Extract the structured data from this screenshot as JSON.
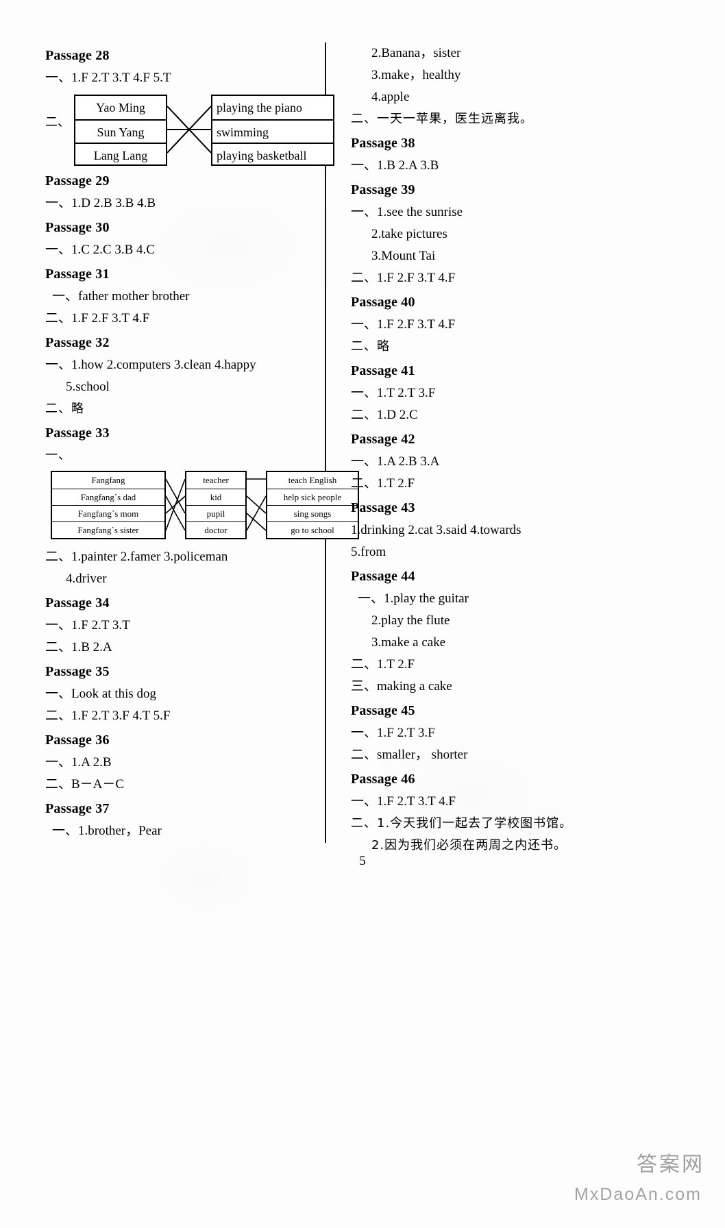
{
  "page": {
    "number": "5",
    "watermark_cjk": "答案网",
    "watermark_latin": "MxDaoAn.com"
  },
  "left_column": {
    "passages": [
      {
        "title": "Passage 28",
        "lines": [
          {
            "text": "一、1.F   2.T   3.T   4.F   5.T"
          }
        ],
        "diagram": {
          "type": "match-2col",
          "label": "二、",
          "left_items": [
            "Yao Ming",
            "Sun Yang",
            "Lang Lang"
          ],
          "right_items": [
            "playing the piano",
            "swimming",
            "playing basketball"
          ],
          "connections": [
            [
              0,
              2
            ],
            [
              1,
              1
            ],
            [
              2,
              0
            ]
          ]
        }
      },
      {
        "title": "Passage 29",
        "lines": [
          {
            "text": "一、1.D   2.B   3.B   4.B"
          }
        ]
      },
      {
        "title": "Passage 30",
        "lines": [
          {
            "text": "一、1.C   2.C   3.B   4.C"
          }
        ]
      },
      {
        "title": "Passage 31",
        "lines": [
          {
            "text": "一、father   mother   brother"
          },
          {
            "text": "二、1.F   2.F   3.T   4.F"
          }
        ]
      },
      {
        "title": "Passage 32",
        "lines": [
          {
            "text": "一、1.how   2.computers  3.clean   4.happy"
          },
          {
            "text": "5.school",
            "indent": true
          },
          {
            "text": "二、略"
          }
        ]
      },
      {
        "title": "Passage 33",
        "lines": [
          {
            "text": "一、"
          }
        ],
        "diagram": {
          "type": "match-3col",
          "col1": [
            "Fangfang",
            "Fangfang`s dad",
            "Fangfang`s mom",
            "Fangfang`s sister"
          ],
          "col2": [
            "teacher",
            "kid",
            "pupil",
            "doctor"
          ],
          "col3": [
            "teach English",
            "help sick people",
            "sing songs",
            "go to school"
          ],
          "links_a": [
            [
              0,
              2
            ],
            [
              1,
              3
            ],
            [
              2,
              1
            ],
            [
              3,
              0
            ]
          ],
          "links_b": [
            [
              0,
              0
            ],
            [
              1,
              2
            ],
            [
              2,
              3
            ],
            [
              3,
              1
            ]
          ]
        },
        "lines_after": [
          {
            "text": "二、1.painter   2.famer   3.policeman"
          },
          {
            "text": "4.driver",
            "indent": true
          }
        ]
      },
      {
        "title": "Passage 34",
        "lines": [
          {
            "text": "一、1.F   2.T   3.T"
          },
          {
            "text": "二、1.B   2.A"
          }
        ]
      },
      {
        "title": "Passage 35",
        "lines": [
          {
            "text": "一、Look at this dog"
          },
          {
            "text": "二、1.F   2.T   3.F   4.T   5.F"
          }
        ]
      },
      {
        "title": "Passage 36",
        "lines": [
          {
            "text": "一、1.A   2.B"
          },
          {
            "text": "二、B－A－C"
          }
        ]
      },
      {
        "title": "Passage 37",
        "lines": [
          {
            "text": "一、1.brother，Pear"
          }
        ]
      }
    ]
  },
  "right_column": {
    "passages": [
      {
        "title": "",
        "lines": [
          {
            "text": "2.Banana，sister",
            "indent": true
          },
          {
            "text": "3.make，healthy",
            "indent": true
          },
          {
            "text": "4.apple",
            "indent": true
          },
          {
            "text": "二、一天一苹果，医生远离我。",
            "cjk": true
          }
        ]
      },
      {
        "title": "Passage 38",
        "lines": [
          {
            "text": "一、1.B   2.A   3.B"
          }
        ]
      },
      {
        "title": "Passage 39",
        "lines": [
          {
            "text": "一、1.see the sunrise"
          },
          {
            "text": "2.take pictures",
            "indent": true
          },
          {
            "text": "3.Mount Tai",
            "indent": true
          },
          {
            "text": "二、1.F   2.F   3.T   4.F"
          }
        ]
      },
      {
        "title": "Passage 40",
        "lines": [
          {
            "text": "一、1.F   2.F   3.T   4.F"
          },
          {
            "text": "二、略"
          }
        ]
      },
      {
        "title": "Passage 41",
        "lines": [
          {
            "text": "一、1.T   2.T   3.F"
          },
          {
            "text": "二、1.D   2.C"
          }
        ]
      },
      {
        "title": "Passage 42",
        "lines": [
          {
            "text": "一、1.A   2.B   3.A"
          },
          {
            "text": "二、1.T   2.F"
          }
        ]
      },
      {
        "title": "Passage 43",
        "lines": [
          {
            "text": "1.drinking   2.cat   3.said   4.towards"
          },
          {
            "text": "5.from"
          }
        ]
      },
      {
        "title": "Passage 44",
        "lines": [
          {
            "text": "一、1.play the guitar"
          },
          {
            "text": "2.play the flute",
            "indent": true
          },
          {
            "text": "3.make a cake",
            "indent": true
          },
          {
            "text": "二、1.T   2.F"
          },
          {
            "text": "三、making a cake"
          }
        ]
      },
      {
        "title": "Passage 45",
        "lines": [
          {
            "text": "一、1.F   2.T   3.F"
          },
          {
            "text": "二、smaller，  shorter"
          }
        ]
      },
      {
        "title": "Passage 46",
        "lines": [
          {
            "text": "一、1.F   2.T   3.T   4.F"
          },
          {
            "text": "二、1.今天我们一起去了学校图书馆。",
            "cjk": true
          },
          {
            "text": "2.因为我们必须在两周之内还书。",
            "cjk": true,
            "indent": true
          }
        ]
      }
    ]
  }
}
